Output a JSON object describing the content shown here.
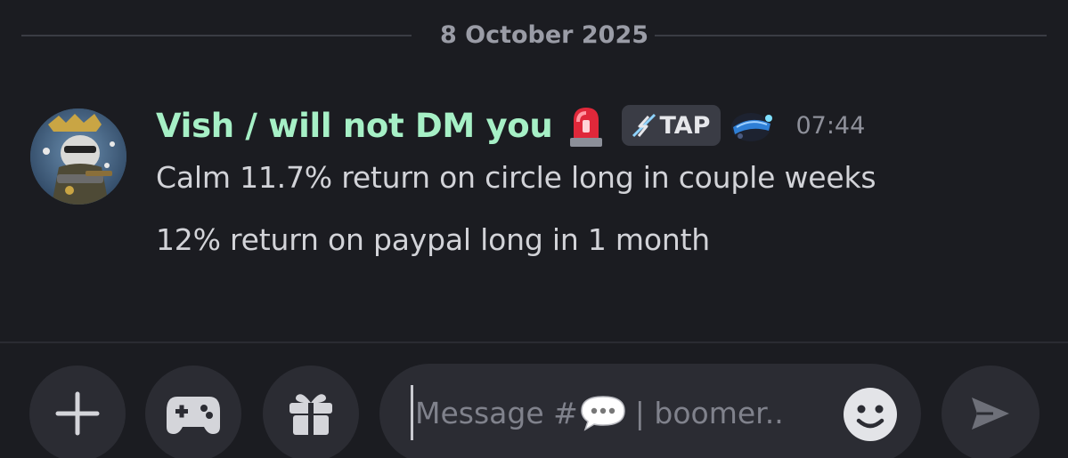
{
  "divider": {
    "date": "8 October 2025"
  },
  "message": {
    "username": "Vish / will not DM you",
    "tag": "TAP",
    "time": "07:44",
    "lines": [
      "Calm 11.7% return on circle long in couple weeks",
      "12% return on paypal long in 1 month"
    ],
    "icons": {
      "siren": "rotating-light-emoji",
      "tag_icon": "lightning-icon",
      "badge": "space-helmet-icon"
    }
  },
  "composer": {
    "placeholder_prefix": "Message #",
    "placeholder_suffix": " | boomer..",
    "buttons": {
      "add": "plus-icon",
      "games": "gamepad-icon",
      "gift": "gift-icon",
      "emoji": "smiley-icon",
      "send": "send-icon"
    }
  },
  "colors": {
    "background": "#1b1c21",
    "username": "#a6f0c6",
    "body_text": "#d2d3d8",
    "muted": "#8e909a",
    "button_bg": "#2b2c33"
  }
}
